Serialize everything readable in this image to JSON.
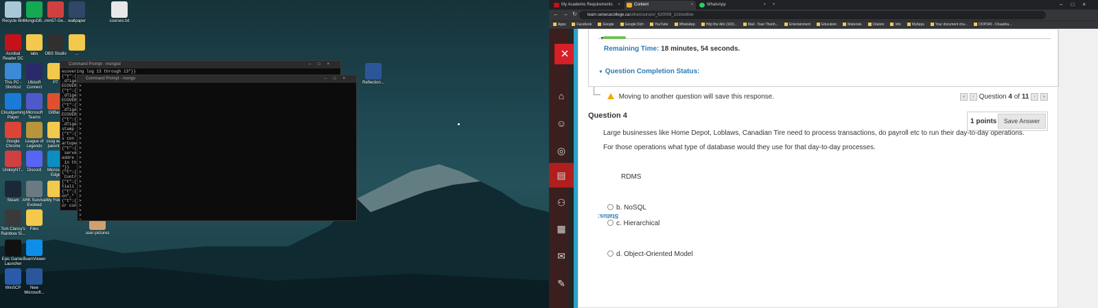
{
  "desktop": {
    "icons": [
      {
        "label": "Recycle Bin",
        "color": "#a8c8d8"
      },
      {
        "label": "MongoDB...",
        "color": "#13aa52"
      },
      {
        "label": "mm57-Ge...",
        "color": "#d04040"
      },
      {
        "label": "wallpaper",
        "color": "#30476a"
      },
      {
        "label": "courses.txt",
        "color": "#e8e8e8"
      },
      {
        "label": "Acrobat Reader DC",
        "color": "#c4121a"
      },
      {
        "label": "labs",
        "color": "#f2c94c"
      },
      {
        "label": "OBS Studio",
        "color": "#303030"
      },
      {
        "label": "...",
        "color": "#f2c94c"
      },
      {
        "label": "This PC - Shortcut",
        "color": "#3a8ad6"
      },
      {
        "label": "Ubisoft Connect",
        "color": "#2a2a6a"
      },
      {
        "label": "PT",
        "color": "#f2c94c"
      },
      {
        "label": "Cloudgaming Player",
        "color": "#1a7ad6"
      },
      {
        "label": "Microsoft Teams",
        "color": "#5059c9"
      },
      {
        "label": "GitBash",
        "color": "#e05030"
      },
      {
        "label": "Google Chrome",
        "color": "#db4437"
      },
      {
        "label": "League of Legends",
        "color": "#b8953a"
      },
      {
        "label": "csog wa... parent ic",
        "color": "#f2c94c"
      },
      {
        "label": "UnikeyNT...",
        "color": "#d04040"
      },
      {
        "label": "Discord",
        "color": "#5865f2"
      },
      {
        "label": "Microsoft Edge",
        "color": "#0c8ec2"
      },
      {
        "label": "Steam",
        "color": "#1b2838"
      },
      {
        "label": "ARK Survival Evolved",
        "color": "#6a7a80"
      },
      {
        "label": "My Folder",
        "color": "#f2c94c"
      },
      {
        "label": "Tom Clancy's Rainbow Si...",
        "color": "#3a3a3a"
      },
      {
        "label": "Files",
        "color": "#f2c94c"
      },
      {
        "label": "user-pictures",
        "color": "#d0a070"
      },
      {
        "label": "Epic Games Launcher",
        "color": "#111111"
      },
      {
        "label": "TeamViewer",
        "color": "#0e8ee9"
      },
      {
        "label": "WinSCP",
        "color": "#2a5aaa"
      },
      {
        "label": "New Microsoft...",
        "color": "#2b579a"
      },
      {
        "label": "Reflection...",
        "color": "#2b579a"
      }
    ],
    "cmd1_title": "Command Prompt - mongod",
    "cmd1_text": "ecovering log 13 through 13\"}}\n{\"t\":{\n.dTiger\nECOVER\n{\"t\":{\n.dTiger\nECOVER\n{\"t\":{\n.dTiger\nECOVER\n{\"t\":{\n.dTiger\nstamp\n{\"t\":{\ns con\nartupw\n{\"t\":{\n serve\naddre\n in th\n\"}}\n{\"t\":{\n Contr\n{\"t\":{\ntiali\n{\"t\":{\non\",\"\n{\"t\":{\nor con",
    "cmd2_title": "Command Prompt - mongo",
    "cmd2_text": ">\n>\n>\n>\n>\n>\n>\n>\n>\n>\n>\n>\n>\n>\n>\n>\n>\n>\n>\n>\n>\n>\n>\n>\n>\n>\n>\n>\n>"
  },
  "browser": {
    "tabs": [
      {
        "label": "My Academic Requirements",
        "favcolor": "#c4121a"
      },
      {
        "label": "Content",
        "favcolor": "#f5a623"
      },
      {
        "label": "WhatsApp",
        "favcolor": "#25d366"
      }
    ],
    "new_tab": "+",
    "url_host": "learn.senecacollege.ca",
    "url_path": "/ultra/courses/_620008_1/cl/outline",
    "bookmarks": [
      "Apps",
      "Facebook",
      "Google",
      "Google Dịch",
      "YouTube",
      "WhatsApp",
      "Hộp thư đến (163)...",
      "Mail - Toan Thanh...",
      "Entertainment",
      "Education",
      "Materials",
      "Citation",
      "Info",
      "MyApps",
      "Your document cha...",
      "OOP345 - Chaabha..."
    ]
  },
  "quiz": {
    "close_icon": "×",
    "remaining_label": "Remaining Time:",
    "remaining_minutes": "18",
    "minutes_word": "minutes,",
    "remaining_seconds": "54",
    "seconds_word": "seconds.",
    "completion_status": "Question Completion Status:",
    "warning": "Moving to another question will save this response.",
    "pager_prefix": "Question",
    "current_q": "4",
    "of_word": "of",
    "total_q": "11",
    "question_title": "Question 4",
    "points": "1 points",
    "save_button": "Save Answer",
    "question_line1": "Large businesses like Home Depot, Loblaws, Canadian Tire need to process transactions, do payroll etc to run their day-to-day operations.",
    "question_line2": "For those operations what type of database would they use for that day-to-day processes.",
    "option_a": "RDMS",
    "status_mirror": "Status:",
    "option_b": "b. NoSQL",
    "option_c": "c. Hierarchical",
    "option_d": "d. Object-Oriented Model"
  },
  "colors": {
    "accent": "#2a7ab5",
    "brand_red": "#d61f26",
    "progress": "#6dc24b"
  }
}
